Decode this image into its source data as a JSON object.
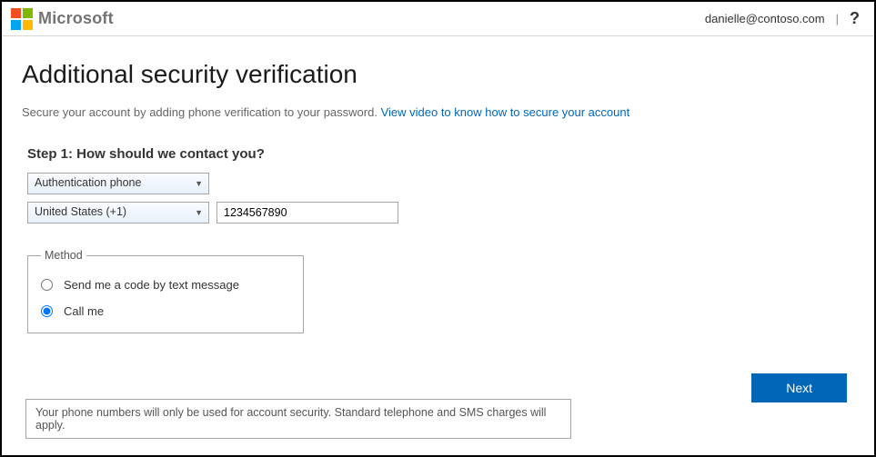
{
  "header": {
    "brand": "Microsoft",
    "user_email": "danielle@contoso.com",
    "help_glyph": "?"
  },
  "page": {
    "title": "Additional security verification",
    "desc_prefix": "Secure your account by adding phone verification to your password. ",
    "desc_link": "View video to know how to secure your account",
    "step_label": "Step 1: How should we contact you?"
  },
  "form": {
    "contact_method_selected": "Authentication phone",
    "country_selected": "United States (+1)",
    "phone_value": "1234567890",
    "method_legend": "Method",
    "radio_text": "Send me a code by text message",
    "radio_call": "Call me"
  },
  "actions": {
    "next": "Next"
  },
  "footnote": "Your phone numbers will only be used for account security. Standard telephone and SMS charges will apply."
}
